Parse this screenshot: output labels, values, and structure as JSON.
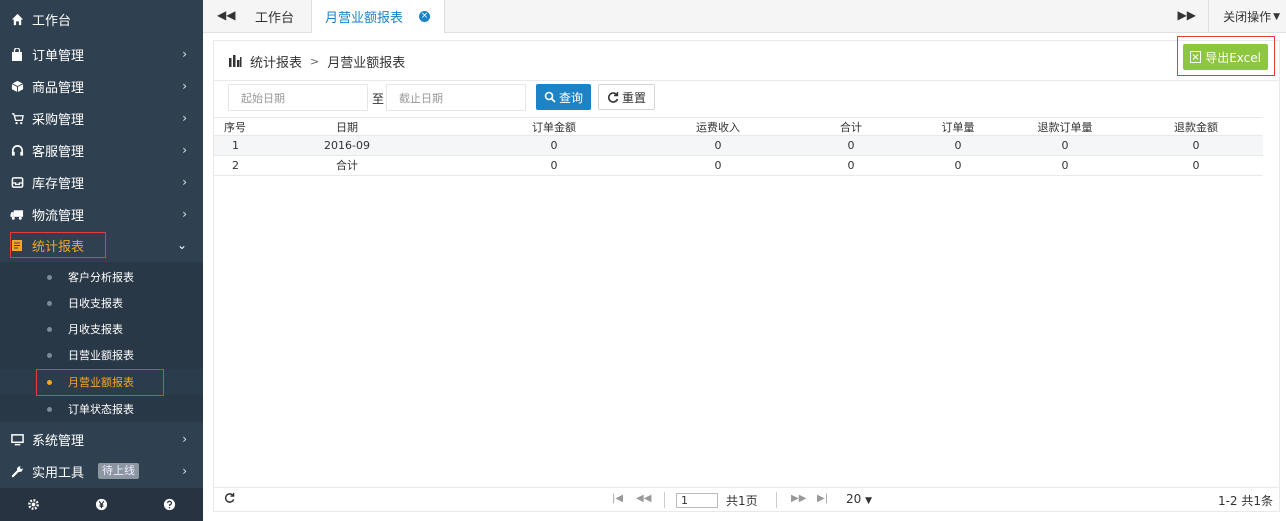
{
  "sidebar": {
    "home": "工作台",
    "items": [
      {
        "label": "订单管理",
        "icon": "bag-icon"
      },
      {
        "label": "商品管理",
        "icon": "cube-icon"
      },
      {
        "label": "采购管理",
        "icon": "cart-icon"
      },
      {
        "label": "客服管理",
        "icon": "headset-icon"
      },
      {
        "label": "库存管理",
        "icon": "inbox-icon"
      },
      {
        "label": "物流管理",
        "icon": "truck-icon"
      },
      {
        "label": "统计报表",
        "icon": "report-icon"
      },
      {
        "label": "系统管理",
        "icon": "monitor-icon"
      },
      {
        "label": "实用工具",
        "icon": "wrench-icon"
      }
    ],
    "submenu": [
      "客户分析报表",
      "日收支报表",
      "月收支报表",
      "日营业额报表",
      "月营业额报表",
      "订单状态报表"
    ],
    "tools_badge": "待上线"
  },
  "tabs": {
    "home": "工作台",
    "current": "月营业额报表",
    "close_ops": "关闭操作"
  },
  "breadcrumb": {
    "parent": "统计报表",
    "current": "月营业额报表"
  },
  "toolbar": {
    "export_label": "导出Excel",
    "start_placeholder": "起始日期",
    "to_label": "至",
    "end_placeholder": "截止日期",
    "query_label": "查询",
    "reset_label": "重置"
  },
  "table": {
    "columns": [
      "序号",
      "日期",
      "订单金额",
      "运费收入",
      "合计",
      "订单量",
      "退款订单量",
      "退款金额"
    ],
    "rows": [
      [
        "1",
        "2016-09",
        "0",
        "0",
        "0",
        "0",
        "0",
        "0"
      ],
      [
        "2",
        "合计",
        "0",
        "0",
        "0",
        "0",
        "0",
        "0"
      ]
    ]
  },
  "pager": {
    "page": "1",
    "total_pages": "共1页",
    "page_size": "20",
    "summary": "1-2  共1条"
  },
  "colors": {
    "sidebar_bg": "#2f4050",
    "accent_orange": "#f5a623",
    "accent_blue": "#1c84c6",
    "export_green": "#8dc63f",
    "highlight_red": "#e53c3c"
  }
}
